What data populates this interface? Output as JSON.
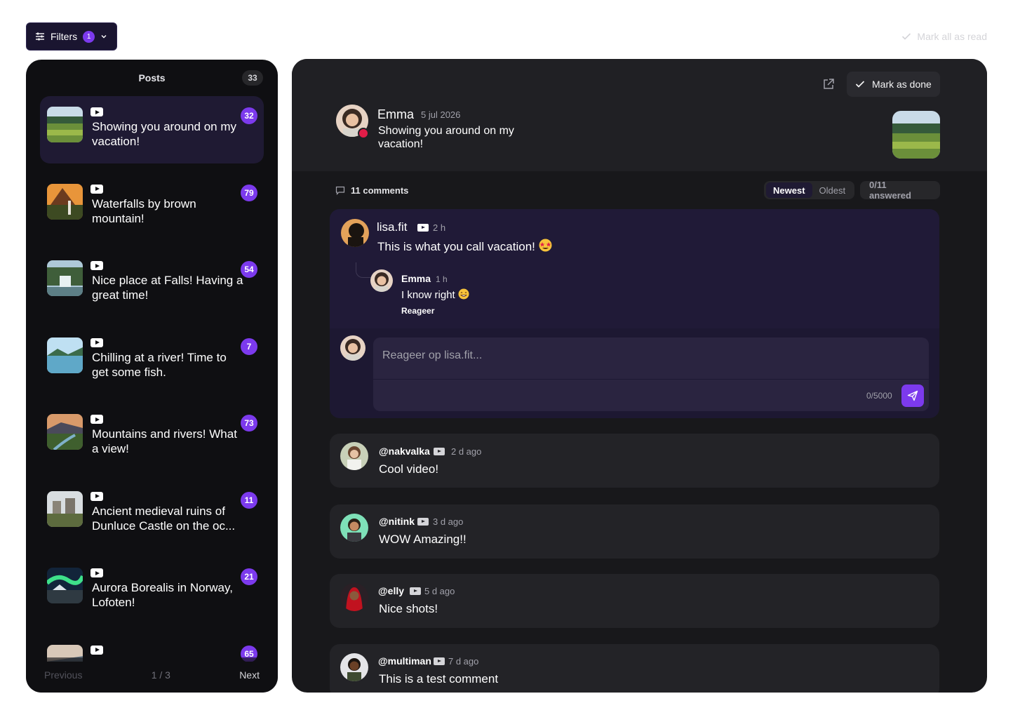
{
  "toolbar": {
    "filters_label": "Filters",
    "filters_count": "1",
    "mark_all_label": "Mark all as read"
  },
  "posts": {
    "title": "Posts",
    "count": "33",
    "items": [
      {
        "title": "Showing you around on my vacation!",
        "count": "32",
        "thumb": "meadow",
        "platform": "youtube-icon"
      },
      {
        "title": "Waterfalls by brown mountain!",
        "count": "79",
        "thumb": "sunset-mountain",
        "platform": "youtube-icon"
      },
      {
        "title": "Nice place at Falls! Having a great time!",
        "count": "54",
        "thumb": "waterfall",
        "platform": "youtube-icon"
      },
      {
        "title": "Chilling at a river! Time to get some fish.",
        "count": "7",
        "thumb": "lake",
        "platform": "youtube-icon"
      },
      {
        "title": "Mountains and rivers! What a view!",
        "count": "73",
        "thumb": "river-valley",
        "platform": "youtube-icon"
      },
      {
        "title": "Ancient medieval ruins of Dunluce Castle on the oc...",
        "count": "11",
        "thumb": "castle",
        "platform": "youtube-icon"
      },
      {
        "title": "Aurora Borealis in Norway, Lofoten!",
        "count": "21",
        "thumb": "aurora",
        "platform": "youtube-icon"
      },
      {
        "title": "",
        "count": "65",
        "thumb": "sky",
        "platform": "youtube-icon"
      }
    ],
    "pager": {
      "previous": "Previous",
      "page": "1 / 3",
      "next": "Next"
    }
  },
  "detail": {
    "mark_done_label": "Mark as done",
    "author": {
      "name": "Emma",
      "date": "5 jul 2026",
      "text": "Showing you around on my vacation!"
    },
    "comments_label": "11 comments",
    "sort": {
      "newest": "Newest",
      "oldest": "Oldest"
    },
    "answered": "0/11 answered",
    "thread": {
      "name": "lisa.fit",
      "time": "2 h",
      "text": "This is what you call vacation!",
      "reply": {
        "name": "Emma",
        "time": "1 h",
        "text": "I know right",
        "action": "Reageer"
      },
      "input_placeholder": "Reageer op lisa.fit...",
      "counter": "0/5000"
    },
    "comments": [
      {
        "name": "@nakvalka",
        "time": "2 d ago",
        "text": "Cool video!"
      },
      {
        "name": "@nitink",
        "time": "3 d ago",
        "text": "WOW Amazing!!"
      },
      {
        "name": "@elly",
        "time": "5 d ago",
        "text": "Nice shots!"
      },
      {
        "name": "@multiman",
        "time": "7 d ago",
        "text": "This is a test comment"
      }
    ]
  },
  "colors": {
    "accent": "#7c3aed",
    "panel": "#18181b",
    "posts_panel": "#0f0f12",
    "youtube_red": "#e11d48"
  }
}
